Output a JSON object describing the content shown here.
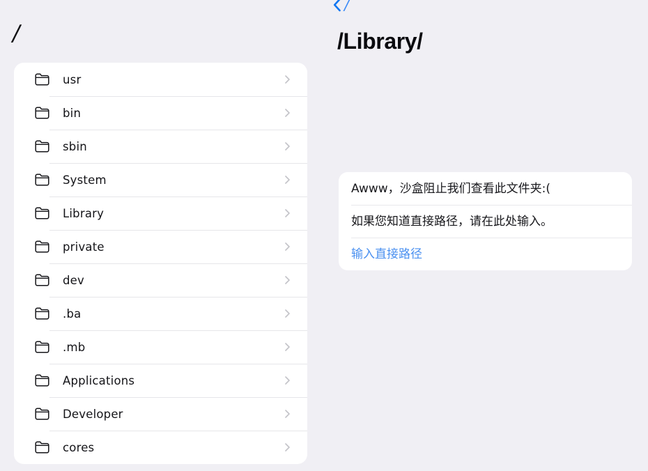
{
  "background_color": "#f0eff4",
  "card_color": "#ffffff",
  "accent_color": "#3d8cf7",
  "link_color": "#4a90f0",
  "divider_color": "#e6e6e9",
  "chevron_color": "#c4c4c9",
  "left_pane": {
    "title": "/",
    "folder_icon_name": "folder-icon",
    "disclosure_icon_name": "chevron-right-icon",
    "items": [
      {
        "label": "usr"
      },
      {
        "label": "bin"
      },
      {
        "label": "sbin"
      },
      {
        "label": "System"
      },
      {
        "label": "Library"
      },
      {
        "label": "private"
      },
      {
        "label": "dev"
      },
      {
        "label": ".ba"
      },
      {
        "label": ".mb"
      },
      {
        "label": "Applications"
      },
      {
        "label": "Developer"
      },
      {
        "label": "cores"
      }
    ]
  },
  "right_pane": {
    "back_label": "/",
    "back_icon_name": "chevron-left-icon",
    "title": "/Library/",
    "notice": {
      "message": "Awww，沙盒阻止我们查看此文件夹:(",
      "hint": "如果您知道直接路径，请在此处输入。",
      "action_label": "输入直接路径"
    }
  }
}
